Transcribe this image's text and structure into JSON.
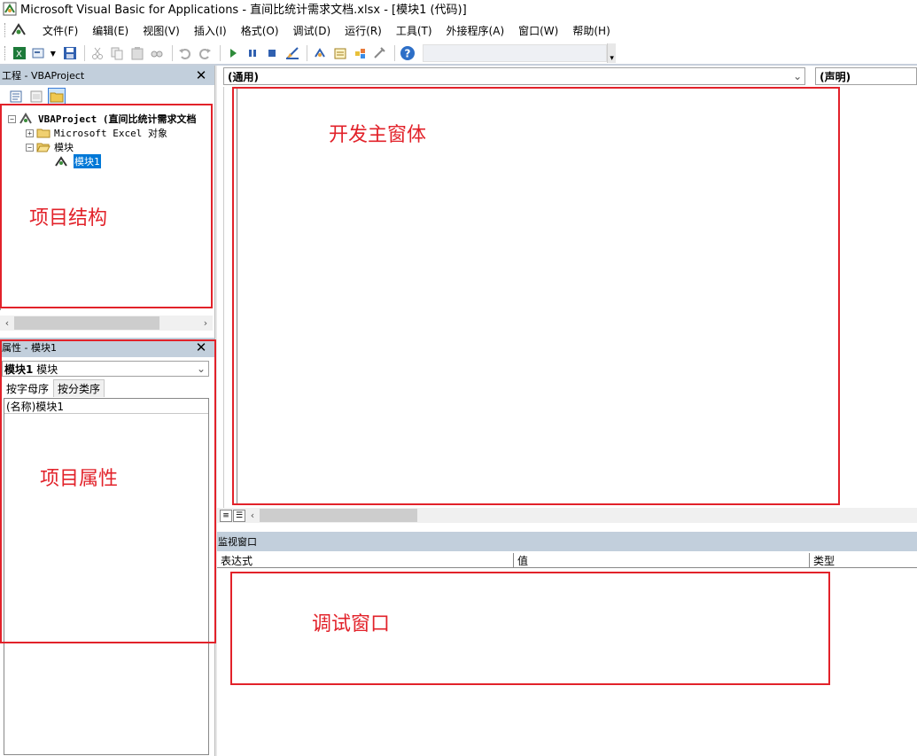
{
  "window": {
    "title": "Microsoft Visual Basic for Applications - 直间比统计需求文档.xlsx - [模块1 (代码)]"
  },
  "menu": {
    "items": [
      "文件(F)",
      "编辑(E)",
      "视图(V)",
      "插入(I)",
      "格式(O)",
      "调试(D)",
      "运行(R)",
      "工具(T)",
      "外接程序(A)",
      "窗口(W)",
      "帮助(H)"
    ]
  },
  "toolbar": {
    "icons": [
      "excel-icon",
      "insert-userform-icon",
      "save-icon",
      "cut-icon",
      "copy-icon",
      "paste-icon",
      "find-icon",
      "undo-icon",
      "redo-icon",
      "run-icon",
      "break-icon",
      "reset-icon",
      "design-mode-icon",
      "project-explorer-icon",
      "properties-icon",
      "object-browser-icon",
      "toolbox-icon",
      "help-icon"
    ]
  },
  "project_pane": {
    "title": "工程 - VBAProject",
    "tree": {
      "root": "VBAProject (直间比统计需求文档",
      "excel_objects": "Microsoft Excel 对象",
      "modules_folder": "模块",
      "module1": "模块1"
    }
  },
  "properties_pane": {
    "title": "属性 - 模块1",
    "object_select": "模块1 模块",
    "object_bold": "模块1",
    "object_type": "模块",
    "tabs": [
      "按字母序",
      "按分类序"
    ],
    "rows": [
      {
        "key": "(名称)",
        "value": "模块1"
      }
    ]
  },
  "code_window": {
    "object_combo": "(通用)",
    "proc_combo": "(声明)"
  },
  "watch_window": {
    "title": "监视窗口",
    "columns": [
      "表达式",
      "值",
      "类型"
    ]
  },
  "annotations": {
    "project_structure": "项目结构",
    "main_window": "开发主窗体",
    "project_properties": "项目属性",
    "debug_window": "调试窗口",
    "color": "#e2222a"
  }
}
